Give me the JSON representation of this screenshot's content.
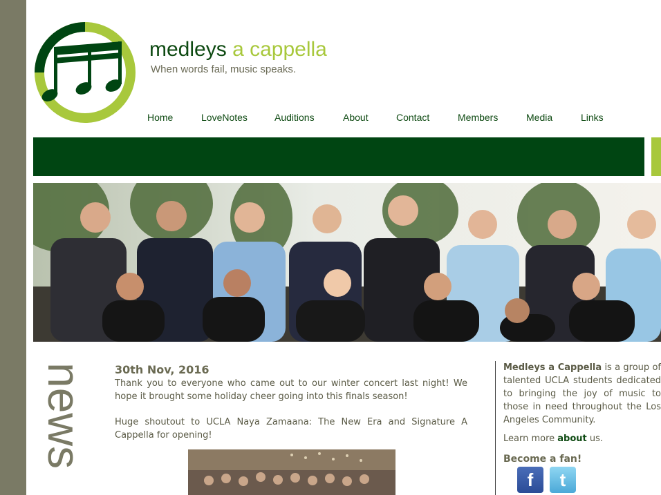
{
  "brand": {
    "title_part1": "medleys",
    "title_part2": "a cappella",
    "tagline": "When words fail, music speaks.",
    "colors": {
      "dark_green": "#004512",
      "lime": "#a8c83c",
      "sidebar_gray": "#7a7a65"
    }
  },
  "nav": {
    "items": [
      {
        "label": "Home"
      },
      {
        "label": "LoveNotes"
      },
      {
        "label": "Auditions"
      },
      {
        "label": "About"
      },
      {
        "label": "Contact"
      },
      {
        "label": "Members"
      },
      {
        "label": "Media"
      },
      {
        "label": "Links"
      }
    ]
  },
  "news": {
    "section_label": "news",
    "post": {
      "date": "30th Nov, 2016",
      "paragraph1": "Thank you to everyone who came out to our winter concert last night!  We hope it brought some holiday cheer going into this finals season!",
      "paragraph2": "Huge shoutout to UCLA Naya Zamaana: The New Era and Signature A Cappella for opening!"
    }
  },
  "sidebar": {
    "org_name": "Medleys a Cappella",
    "about_text": " is a group of talented UCLA students dedicated to bringing the joy of music to those in need throughout the Los Angeles Community.",
    "learn_more_prefix": "Learn more ",
    "learn_more_link": "about",
    "learn_more_suffix": " us.",
    "fan_title": "Become a fan!",
    "social": [
      {
        "icon": "facebook-icon",
        "glyph": "f"
      },
      {
        "icon": "twitter-icon",
        "glyph": "t"
      }
    ]
  }
}
